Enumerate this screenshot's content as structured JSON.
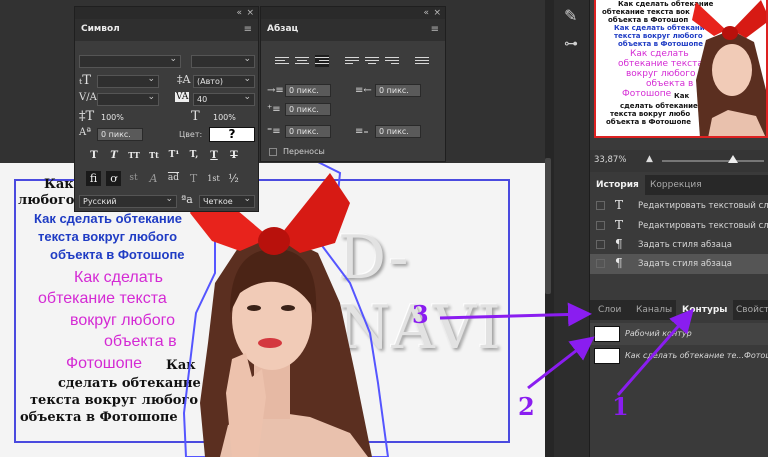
{
  "canvas": {
    "black_lines_top": [
      "Как о",
      "любого о"
    ],
    "blue_lines": [
      "Как сделать обтекание",
      "текста вокруг любого",
      "объекта в Фотошопе"
    ],
    "magenta_lines": [
      "Как сделать",
      "обтекание текста",
      "вокруг любого",
      "объекта в",
      "Фотошопе"
    ],
    "black_lines_bottom": [
      "Как",
      "сделать обтекание",
      "текста вокруг любого",
      "объекта в Фотошопе"
    ],
    "brand_text": "D-NAVI"
  },
  "symbol_panel": {
    "title": "Символ",
    "leading_value": "(Авто)",
    "tracking_value": "40",
    "vscale": "100%",
    "hscale": "100%",
    "baseline": "0 пикс.",
    "color_label": "Цвет:",
    "color_swatch": "?",
    "style_buttons": [
      "T",
      "T",
      "TT",
      "Tt",
      "T¹",
      "T,",
      "T",
      "T"
    ],
    "feature_buttons": [
      "fi",
      "ơ",
      "st",
      "A",
      "ad",
      "T",
      "1st",
      "½"
    ],
    "language": "Русский",
    "aa_label": "a",
    "antialias": "Четкое"
  },
  "para_panel": {
    "title": "Абзац",
    "indent_left": "0 пикс.",
    "indent_right": "0 пикс.",
    "indent_first": "0 пикс.",
    "space_before": "0 пикс.",
    "space_after": "0 пикс.",
    "hyphenate_label": "Переносы"
  },
  "thumbnail_text": {
    "black": [
      "Как сделать обтекание",
      "обтекание текста вок",
      "объекта в Фотошоп"
    ],
    "magenta": [
      "Как сделать обтекание",
      "текста вокруг любого",
      "объекта в Фотошопе"
    ],
    "pink": [
      "Как сделать",
      "обтекание текста",
      "вокруг любого",
      "объекта в",
      "Фотошопе"
    ],
    "bottom": [
      "Как",
      "сделать обтекание",
      "текста вокруг любо",
      "объекта в Фотошопе"
    ]
  },
  "zoom": "33,87%",
  "history_tabs": [
    "История",
    "Коррекция"
  ],
  "history": [
    {
      "icon": "T",
      "label": "Редактировать текстовый слой"
    },
    {
      "icon": "T",
      "label": "Редактировать текстовый слой"
    },
    {
      "icon": "¶",
      "label": "Задать стиля абзаца"
    },
    {
      "icon": "¶",
      "label": "Задать стиля абзаца"
    }
  ],
  "layer_tabs": [
    "Слои",
    "Каналы",
    "Контуры",
    "Свойств"
  ],
  "paths": [
    {
      "label": "Рабочий контур"
    },
    {
      "label": "Как сделать обтекание те...Фотошопе"
    }
  ],
  "annotations": {
    "n1": "1",
    "n2": "2",
    "n3": "3"
  },
  "colors": {
    "annotation": "#8a1df0",
    "frame": "#4a4adf",
    "magenta": "#d42ad4",
    "blue": "#1f3cc4"
  }
}
